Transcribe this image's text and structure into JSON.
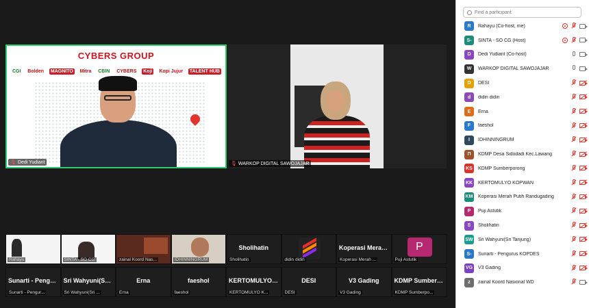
{
  "main_tiles": {
    "speaker": {
      "name": "Dedi Yudiant",
      "banner_title": "CYBERS GROUP",
      "logos": [
        "CGI",
        "Bolden",
        "MAGNITO",
        "Mitra",
        "CBIN",
        "CYBERS",
        "Koji",
        "Kopi Jujur",
        "TALENT HUB"
      ]
    },
    "second": {
      "name": "WARKOP DIGITAL SAWOJAJAR"
    }
  },
  "gallery_row1": [
    {
      "kind": "video",
      "label": "Rahayu"
    },
    {
      "kind": "video",
      "label": "SINTA - SO CG"
    },
    {
      "kind": "video",
      "label": "zainal Koord Nas..."
    },
    {
      "kind": "video",
      "label": "IDHINNINGRUM"
    },
    {
      "kind": "name",
      "big": "Sholihatin",
      "label": "Sholihatin"
    },
    {
      "kind": "logo",
      "label": "didin didin"
    },
    {
      "kind": "name",
      "big": "Koperasi Merah...",
      "label": "Koperasi Merah ..."
    },
    {
      "kind": "avatar",
      "avatar": "P",
      "label": "Puji Astutik"
    }
  ],
  "gallery_row2": [
    {
      "big": "Sunarti - Pengu...",
      "label": "Sunarti - Pengur..."
    },
    {
      "big": "Sri Wahyuni(Sri...",
      "label": "Sri Wahyuni(Sri ..."
    },
    {
      "big": "Erna",
      "label": "Erna"
    },
    {
      "big": "faeshol",
      "label": "faeshol"
    },
    {
      "big": "KERTOMULYO K...",
      "label": "KERTOMULYO K..."
    },
    {
      "big": "DESI",
      "label": "DESI"
    },
    {
      "big": "V3 Gading",
      "label": "V3 Gading"
    },
    {
      "big": "KDMP Sumberp...",
      "label": "KDMP Sumberpo..."
    }
  ],
  "participants_panel": {
    "search_placeholder": "Find a participant",
    "list": [
      {
        "initials": "R",
        "name": "Rahayu (Co-host, me)",
        "color": "#2a78c9",
        "mic": "muted",
        "cam": "off",
        "rec": true
      },
      {
        "initials": "S-",
        "name": "SINTA - SO CG (Host)",
        "color": "#1a8c7a",
        "mic": "muted",
        "cam": "off",
        "rec": true
      },
      {
        "initials": "D",
        "name": "Dedi Yudiant (Co-host)",
        "color": "#8a45c2",
        "mic": "on",
        "cam": "on",
        "rec": false
      },
      {
        "initials": "W",
        "name": "WARKOP DIGITAL SAWOJAJAR",
        "color": "#333333",
        "mic": "on",
        "cam": "on",
        "rec": false
      },
      {
        "initials": "D",
        "name": "DESI",
        "color": "#e6a100",
        "mic": "muted",
        "cam": "muted",
        "rec": false
      },
      {
        "initials": "d",
        "name": "didin didin",
        "color": "#8b4bb2",
        "mic": "muted",
        "cam": "muted",
        "rec": false
      },
      {
        "initials": "E",
        "name": "Erna",
        "color": "#e06d1c",
        "mic": "muted",
        "cam": "muted",
        "rec": false
      },
      {
        "initials": "F",
        "name": "faeshol",
        "color": "#2a78c9",
        "mic": "muted",
        "cam": "muted",
        "rec": false
      },
      {
        "initials": "I",
        "name": "IDHINNINGRUM",
        "color": "#2f4a5e",
        "mic": "muted",
        "cam": "muted",
        "rec": false
      },
      {
        "initials": "П",
        "name": "KDMP Desa Sidodadi Kec.Lawang",
        "color": "#a0522d",
        "mic": "muted",
        "cam": "muted",
        "rec": false
      },
      {
        "initials": "KS",
        "name": "KDMP Sumberporong",
        "color": "#d9342b",
        "mic": "muted",
        "cam": "muted",
        "rec": false
      },
      {
        "initials": "KK",
        "name": "KERTOMULYO KOPWAN",
        "color": "#8a45c2",
        "mic": "muted",
        "cam": "muted",
        "rec": false
      },
      {
        "initials": "KM",
        "name": "Koperasi Merah Putih Randugading",
        "color": "#1a8c7a",
        "mic": "muted",
        "cam": "muted",
        "rec": false
      },
      {
        "initials": "P",
        "name": "Puji Astutik",
        "color": "#b6286f",
        "mic": "muted",
        "cam": "muted",
        "rec": false
      },
      {
        "initials": "S",
        "name": "Sholihatin",
        "color": "#8a45c2",
        "mic": "muted",
        "cam": "muted",
        "rec": false
      },
      {
        "initials": "SW",
        "name": "Sri Wahyuni(Sri Tanjung)",
        "color": "#1a9c8c",
        "mic": "muted",
        "cam": "muted",
        "rec": false
      },
      {
        "initials": "S-",
        "name": "Sunarti - Pengurus KOPDES",
        "color": "#2a78c9",
        "mic": "muted",
        "cam": "muted",
        "rec": false
      },
      {
        "initials": "VG",
        "name": "V3 Gading",
        "color": "#7b3fbf",
        "mic": "muted",
        "cam": "muted",
        "rec": false
      },
      {
        "initials": "z",
        "name": "zainal Koord Nasional WD",
        "color": "#6d6d6d",
        "mic": "muted",
        "cam": "on",
        "rec": false
      }
    ]
  }
}
